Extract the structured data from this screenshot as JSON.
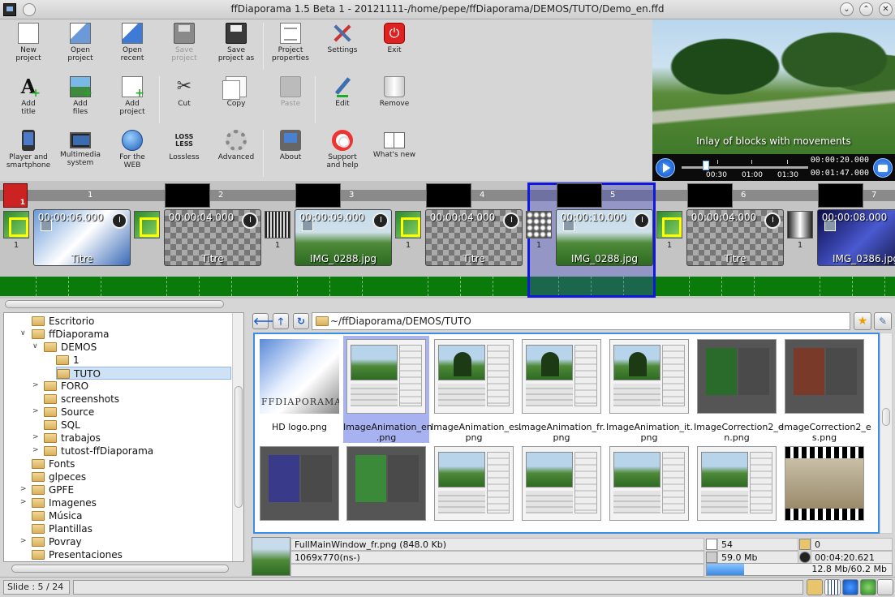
{
  "window": {
    "title": "ffDiaporama 1.5 Beta 1 - 20121111-/home/pepe/ffDiaporama/DEMOS/TUTO/Demo_en.ffd",
    "minimize_glyph": "⌄",
    "maximize_glyph": "⌃",
    "close_glyph": "✕"
  },
  "toolbar": {
    "row1": [
      {
        "label": "New\nproject",
        "icon": "new-document-icon",
        "enabled": true
      },
      {
        "label": "Open\nproject",
        "icon": "open-project-icon",
        "enabled": true
      },
      {
        "label": "Open\nrecent",
        "icon": "open-recent-icon",
        "enabled": true
      },
      {
        "label": "Save\nproject",
        "icon": "save-disk-icon",
        "enabled": false
      },
      {
        "label": "Save\nproject as",
        "icon": "save-as-disk-icon",
        "enabled": true
      },
      {
        "label": "Project\nproperties",
        "icon": "properties-icon",
        "enabled": true
      },
      {
        "label": "Settings",
        "icon": "tools-icon",
        "enabled": true
      },
      {
        "label": "Exit",
        "icon": "exit-power-icon",
        "enabled": true
      }
    ],
    "row2": [
      {
        "label": "Add\ntitle",
        "icon": "add-title-icon",
        "enabled": true
      },
      {
        "label": "Add\nfiles",
        "icon": "add-files-icon",
        "enabled": true
      },
      {
        "label": "Add\nproject",
        "icon": "add-project-icon",
        "enabled": true
      },
      {
        "label": "Cut",
        "icon": "scissors-icon",
        "enabled": true
      },
      {
        "label": "Copy",
        "icon": "copy-icon",
        "enabled": true
      },
      {
        "label": "Paste",
        "icon": "paste-icon",
        "enabled": false
      },
      {
        "label": "Edit",
        "icon": "edit-pencil-icon",
        "enabled": true
      },
      {
        "label": "Remove",
        "icon": "trash-icon",
        "enabled": true
      }
    ],
    "row3": [
      {
        "label": "Player and\nsmartphone",
        "icon": "smartphone-icon",
        "enabled": true
      },
      {
        "label": "Multimedia\nsystem",
        "icon": "tv-icon",
        "enabled": true
      },
      {
        "label": "For the\nWEB",
        "icon": "globe-icon",
        "enabled": true
      },
      {
        "label": "Lossless",
        "icon": "lossless-icon",
        "enabled": true
      },
      {
        "label": "Advanced",
        "icon": "gear-icon",
        "enabled": true
      },
      {
        "label": "About",
        "icon": "about-icon",
        "enabled": true
      },
      {
        "label": "Support\nand help",
        "icon": "lifebuoy-icon",
        "enabled": true
      },
      {
        "label": "What's new",
        "icon": "book-icon",
        "enabled": true
      }
    ],
    "lossless_icon_text": "LOSS\nLESS"
  },
  "preview": {
    "caption": "Inlay of blocks with movements",
    "scale_labels": [
      "00:30",
      "01:00",
      "01:30"
    ],
    "current_time": "00:00:20.000",
    "total_time": "00:01:47.000",
    "position_fraction": 0.19
  },
  "timeline": {
    "corner_badge": "1",
    "slide_numbers": [
      "1",
      "2",
      "3",
      "4",
      "5",
      "6",
      "7"
    ],
    "transitions": [
      {
        "type": "green",
        "count": "1"
      },
      {
        "type": "green",
        "count": ""
      },
      {
        "type": "stripes",
        "count": "1"
      },
      {
        "type": "green",
        "count": "1"
      },
      {
        "type": "dots",
        "count": "1"
      },
      {
        "type": "green",
        "count": "1"
      },
      {
        "type": "gradient",
        "count": "1"
      }
    ],
    "slides": [
      {
        "duration": "00:00:06.000",
        "caption": "Titre",
        "style": "logo"
      },
      {
        "duration": "00:00:04.000",
        "caption": "Titre",
        "style": "checker"
      },
      {
        "duration": "00:00:09.000",
        "caption": "IMG_0288.jpg",
        "style": "photo"
      },
      {
        "duration": "00:00:04.000",
        "caption": "Titre",
        "style": "checker"
      },
      {
        "duration": "00:00:10.000",
        "caption": "IMG_0288.jpg",
        "style": "photo"
      },
      {
        "duration": "00:00:04.000",
        "caption": "Titre",
        "style": "checker"
      },
      {
        "duration": "00:00:08.000",
        "caption": "IMG_0386.jpg",
        "style": "photo-dark"
      }
    ],
    "selected_slide": 5
  },
  "tree": {
    "items": [
      {
        "label": "Escritorio",
        "indent": 0,
        "expander": ""
      },
      {
        "label": "ffDiaporama",
        "indent": 0,
        "expander": "∨"
      },
      {
        "label": "DEMOS",
        "indent": 1,
        "expander": "∨"
      },
      {
        "label": "1",
        "indent": 2,
        "expander": ""
      },
      {
        "label": "TUTO",
        "indent": 2,
        "expander": "",
        "selected": true
      },
      {
        "label": "FORO",
        "indent": 1,
        "expander": ">"
      },
      {
        "label": "screenshots",
        "indent": 1,
        "expander": ""
      },
      {
        "label": "Source",
        "indent": 1,
        "expander": ">"
      },
      {
        "label": "SQL",
        "indent": 1,
        "expander": ""
      },
      {
        "label": "trabajos",
        "indent": 1,
        "expander": ">"
      },
      {
        "label": "tutost-ffDiaporama",
        "indent": 1,
        "expander": ">"
      },
      {
        "label": "Fonts",
        "indent": 0,
        "expander": ""
      },
      {
        "label": "glpeces",
        "indent": 0,
        "expander": ""
      },
      {
        "label": "GPFE",
        "indent": 0,
        "expander": ">"
      },
      {
        "label": "Imagenes",
        "indent": 0,
        "expander": ">"
      },
      {
        "label": "Música",
        "indent": 0,
        "expander": ""
      },
      {
        "label": "Plantillas",
        "indent": 0,
        "expander": ""
      },
      {
        "label": "Povray",
        "indent": 0,
        "expander": ">"
      },
      {
        "label": "Presentaciones",
        "indent": 0,
        "expander": ""
      }
    ]
  },
  "pathbar": {
    "back_glyph": "🡐",
    "up_glyph": "🡑",
    "refresh_glyph": "↻",
    "path": "~/ffDiaporama/DEMOS/TUTO",
    "favorite_glyph": "★",
    "tools_glyph": "✎"
  },
  "files": [
    {
      "name": "HD logo.png",
      "thumb": "logo",
      "brand": "FFDIAPORAMA"
    },
    {
      "name": "ImageAnimation_en\n.png",
      "thumb": "ui",
      "selected": true
    },
    {
      "name": "ImageAnimation_es.\npng",
      "thumb": "photo"
    },
    {
      "name": "ImageAnimation_fr.\npng",
      "thumb": "photo"
    },
    {
      "name": "ImageAnimation_it.\npng",
      "thumb": "photo"
    },
    {
      "name": "ImageCorrection2_e\nn.png",
      "thumb": "corr-green"
    },
    {
      "name": "ImageCorrection2_e\ns.png",
      "thumb": "corr-red"
    },
    {
      "name": "",
      "thumb": "corr-blue"
    },
    {
      "name": "",
      "thumb": "corr-green2"
    },
    {
      "name": "",
      "thumb": "ui"
    },
    {
      "name": "",
      "thumb": "ui"
    },
    {
      "name": "",
      "thumb": "ui"
    },
    {
      "name": "",
      "thumb": "ui"
    },
    {
      "name": "",
      "thumb": "film"
    }
  ],
  "info": {
    "filename": "FullMainWindow_fr.png (848.0 Kb)",
    "dimensions": "1069x770(ns-)",
    "file_count": "54",
    "folder_count": "0",
    "total_size": "59.0 Mb",
    "total_duration": "00:04:20.621",
    "disk_usage": "12.8 Mb/60.2 Mb",
    "disk_fraction": 0.2
  },
  "status": {
    "slide": "Slide : 5 / 24"
  }
}
